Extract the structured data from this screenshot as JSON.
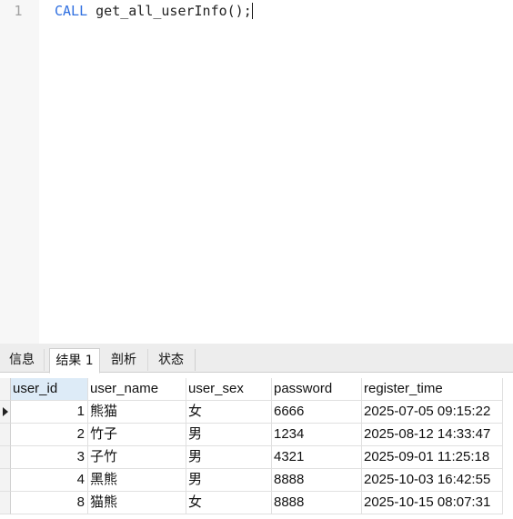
{
  "editor": {
    "line_numbers": [
      "1"
    ],
    "lines": [
      {
        "keyword": "CALL",
        "rest": " get_all_userInfo();"
      }
    ]
  },
  "tabs": [
    {
      "label": "信息",
      "active": false
    },
    {
      "label": "结果 1",
      "active": true
    },
    {
      "label": "剖析",
      "active": false
    },
    {
      "label": "状态",
      "active": false
    }
  ],
  "grid": {
    "columns": [
      "user_id",
      "user_name",
      "user_sex",
      "password",
      "register_time"
    ],
    "sorted_column": "user_id",
    "current_row_index": 0,
    "rows": [
      {
        "user_id": "1",
        "user_name": "熊猫",
        "user_sex": "女",
        "password": "6666",
        "register_time": "2025-07-05 09:15:22"
      },
      {
        "user_id": "2",
        "user_name": "竹子",
        "user_sex": "男",
        "password": "1234",
        "register_time": "2025-08-12 14:33:47"
      },
      {
        "user_id": "3",
        "user_name": "子竹",
        "user_sex": "男",
        "password": "4321",
        "register_time": "2025-09-01 11:25:18"
      },
      {
        "user_id": "4",
        "user_name": "黑熊",
        "user_sex": "男",
        "password": "8888",
        "register_time": "2025-10-03 16:42:55"
      },
      {
        "user_id": "8",
        "user_name": "猫熊",
        "user_sex": "女",
        "password": "8888",
        "register_time": "2025-10-15 08:07:31"
      }
    ]
  },
  "colors": {
    "keyword": "#2f6fe0",
    "sorted_header_bg": "#ddebf7",
    "gutter_bg": "#f7f7f7",
    "panel_bg": "#ededed"
  },
  "icons": {
    "current_row": "triangle-right-icon"
  }
}
